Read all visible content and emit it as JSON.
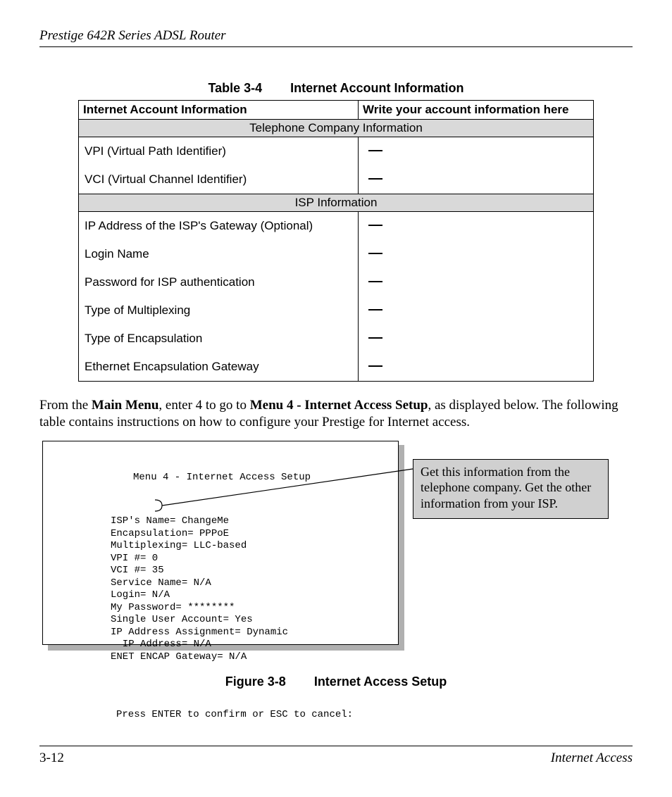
{
  "header": {
    "title": "Prestige 642R Series ADSL Router"
  },
  "table": {
    "caption_prefix": "Table 3-4",
    "caption_title": "Internet Account Information",
    "col1": "Internet Account Information",
    "col2": "Write your account information here",
    "section1": "Telephone Company Information",
    "rows1": [
      "VPI (Virtual Path Identifier)",
      "VCI (Virtual Channel Identifier)"
    ],
    "section2": "ISP Information",
    "rows2": [
      "IP Address of the ISP's Gateway (Optional)",
      "Login Name",
      "Password for ISP authentication",
      "Type of Multiplexing",
      "Type of Encapsulation",
      "Ethernet Encapsulation Gateway"
    ]
  },
  "paragraph": {
    "pre": "From the ",
    "b1": "Main Menu",
    "mid": ", enter 4 to go to ",
    "b2": "Menu 4 - Internet Access Setup",
    "post": ", as displayed below. The following table contains instructions on how to configure your Prestige for Internet access."
  },
  "terminal": {
    "title": "Menu 4 - Internet Access Setup",
    "lines": [
      "ISP's Name= ChangeMe",
      "Encapsulation= PPPoE",
      "Multiplexing= LLC-based",
      "VPI #= 0",
      "VCI #= 35",
      "Service Name= N/A",
      "Login= N/A",
      "My Password= ********",
      "Single User Account= Yes",
      "IP Address Assignment= Dynamic",
      "  IP Address= N/A",
      "ENET ENCAP Gateway= N/A"
    ],
    "footer": "Press ENTER to confirm or ESC to cancel:"
  },
  "callout": {
    "text": "Get this information from the telephone company. Get the other information from your ISP."
  },
  "figure": {
    "caption_prefix": "Figure 3-8",
    "caption_title": "Internet Access Setup"
  },
  "footer": {
    "page": "3-12",
    "section": "Internet Access"
  }
}
